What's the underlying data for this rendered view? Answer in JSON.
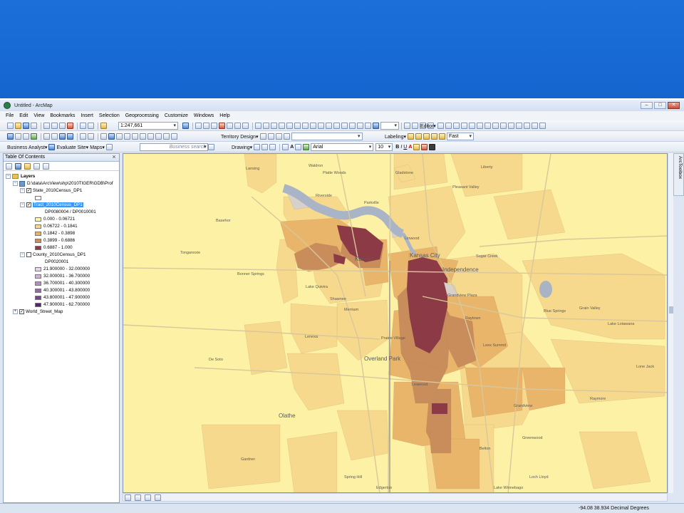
{
  "window": {
    "title": "Untitled - ArcMap",
    "buttons": [
      "–",
      "□",
      "✕"
    ]
  },
  "menu": [
    "File",
    "Edit",
    "View",
    "Bookmarks",
    "Insert",
    "Selection",
    "Geoprocessing",
    "Customize",
    "Windows",
    "Help"
  ],
  "toolbar1": {
    "scale": "1:247,661",
    "editor": "Editor▾"
  },
  "toolbar2": {
    "territory": "Territory Design▾",
    "labeling": "Labeling▾",
    "fast": "Fast"
  },
  "toolbar3": {
    "business_analyst": "Business Analyst▾",
    "evaluate_site": "Evaluate Site▾",
    "maps": "Maps▾",
    "search_placeholder": "Business search",
    "drawing": "Drawing▾",
    "font": "Arial",
    "size": "10",
    "bold": "B",
    "italic": "I",
    "underline": "U"
  },
  "toc": {
    "title": "Table Of Contents",
    "layers_label": "Layers",
    "source_path": "D:\\data\\ArcView\\shp\\2010TIGER\\GDB\\Prof",
    "state_layer": "State_2010Census_DP1",
    "tract_layer": "Tract_2010Census_DP1",
    "tract_field": "DP0080004 / DP0010001",
    "tract_classes": [
      {
        "label": "0.000 - 0.06721",
        "color": "#fdf6b1"
      },
      {
        "label": "0.06722 - 0.1841",
        "color": "#f6d98c"
      },
      {
        "label": "0.1842 - 0.3898",
        "color": "#e6b466"
      },
      {
        "label": "0.3899 - 0.6886",
        "color": "#c98f5b"
      },
      {
        "label": "0.6887 - 1.000",
        "color": "#8b3a45"
      }
    ],
    "county_layer": "County_2010Census_DP1",
    "county_field": "DP0020001",
    "county_classes": [
      {
        "label": "21.900000 - 32.000000",
        "color": "#e6d4e8"
      },
      {
        "label": "32.000001 - 36.700000",
        "color": "#cfb3d6"
      },
      {
        "label": "36.700001 - 40.300000",
        "color": "#b48fbf"
      },
      {
        "label": "40.300001 - 43.800000",
        "color": "#956aa5"
      },
      {
        "label": "43.800001 - 47.900000",
        "color": "#74478a"
      },
      {
        "label": "47.900001 - 62.700000",
        "color": "#52286b"
      }
    ],
    "street_layer": "World_Street_Map"
  },
  "map": {
    "labels": [
      "Lansing",
      "Waldron",
      "Platte Woods",
      "Gladstone",
      "Pleasant Valley",
      "Liberty",
      "Basehor",
      "Kansas",
      "Kansas City",
      "Independence",
      "Bonner Springs",
      "Lake Quivira",
      "Shawnee",
      "Merriam",
      "Prairie Village",
      "Overland Park",
      "Leawood",
      "Raytown",
      "Lees Summit",
      "Blue Springs",
      "Grain Valley",
      "Olathe",
      "Belton",
      "Grandview",
      "Lake Lotawana",
      "Greenwood",
      "Tonganoxie",
      "De Soto",
      "Lenexa",
      "Gardner",
      "Spring Hill",
      "Edgerton",
      "Raymore",
      "Lone Jack",
      "Lake Winnebago",
      "Loch Lloyd",
      "Linwood",
      "Riverside",
      "Parkville",
      "Sugar Creek",
      "Grandview Plaza"
    ],
    "colors": {
      "c0": "#fdf1a5",
      "c1": "#f7d98d",
      "c2": "#e8b56a",
      "c3": "#c98d5c",
      "c4": "#8c3a46",
      "river": "#a9b5c7",
      "gray": "#d7d1c9"
    }
  },
  "status": {
    "coords": "-94.08  38.934 Decimal Degrees"
  },
  "right_dock": "ArcToolbox"
}
